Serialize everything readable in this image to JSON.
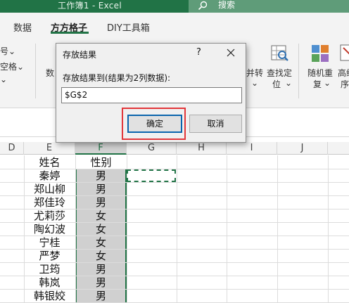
{
  "window": {
    "title": "工作簿1  -  Excel",
    "search_label": "搜索"
  },
  "tabs": [
    {
      "label": "数据"
    },
    {
      "label": "方方格子",
      "active": true
    },
    {
      "label": "DIY工具箱"
    }
  ],
  "ribbon": {
    "left_items": [
      "号",
      "空格"
    ],
    "dropdown_chevron": "⌄",
    "partial_label": "数",
    "merge_label": "并转",
    "merge_sub": "⌄",
    "find_label": "查找定",
    "find_sub": "位",
    "random_label": "随机重",
    "random_sub": "复",
    "advanced_label": "高级",
    "advanced_sub": "序"
  },
  "dialog": {
    "title": "存放结果",
    "help": "?",
    "prompt": "存放结果到(结果为2列数据):",
    "input_value": "$G$2",
    "ok_label": "确定",
    "cancel_label": "取消"
  },
  "grid": {
    "columns": [
      "D",
      "E",
      "F",
      "G",
      "H",
      "I",
      "J"
    ],
    "selected_column": "F",
    "rows": [
      {
        "name": "姓名",
        "gender": "性别"
      },
      {
        "name": "秦婷",
        "gender": "男"
      },
      {
        "name": "郑山柳",
        "gender": "男"
      },
      {
        "name": "郑佳玲",
        "gender": "男"
      },
      {
        "name": "尤莉莎",
        "gender": "女"
      },
      {
        "name": "陶幻波",
        "gender": "女"
      },
      {
        "name": "宁桂",
        "gender": "女"
      },
      {
        "name": "严梦",
        "gender": "女"
      },
      {
        "name": "卫筠",
        "gender": "男"
      },
      {
        "name": "韩岚",
        "gender": "男"
      },
      {
        "name": "韩银姣",
        "gender": "男"
      }
    ]
  },
  "colors": {
    "excel_green": "#217346",
    "highlight_red": "#e2363a"
  }
}
